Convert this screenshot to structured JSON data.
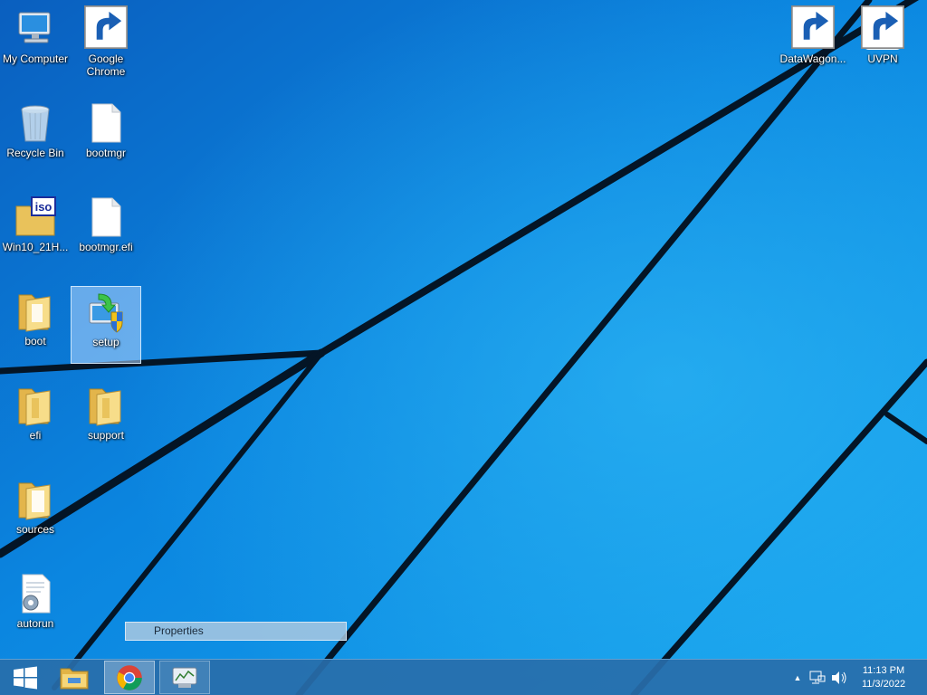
{
  "desktop": {
    "icons": [
      {
        "label": "My Computer"
      },
      {
        "label": "Google Chrome"
      },
      {
        "label": "Recycle Bin"
      },
      {
        "label": "bootmgr"
      },
      {
        "label": "Win10_21H..."
      },
      {
        "label": "bootmgr.efi"
      },
      {
        "label": "boot"
      },
      {
        "label": "setup"
      },
      {
        "label": "efi"
      },
      {
        "label": "support"
      },
      {
        "label": "sources"
      },
      {
        "label": "autorun"
      },
      {
        "label": "DataWagon..."
      },
      {
        "label": "UVPN"
      }
    ],
    "selected_icon": "setup"
  },
  "context_menu": {
    "items": [
      {
        "label": "Properties"
      }
    ]
  },
  "taskbar": {
    "buttons": [
      {
        "icon": "windows-start-icon"
      },
      {
        "icon": "file-explorer-icon"
      },
      {
        "icon": "chrome-icon"
      },
      {
        "icon": "performance-monitor-icon"
      }
    ],
    "tray": {
      "icons": [
        "show-hidden-icons-chevron",
        "network-icon",
        "volume-icon"
      ],
      "time": "11:13 PM",
      "date": "11/3/2022"
    }
  },
  "colors": {
    "wallpaper": "#0a70d2",
    "taskbar": "#286eaa",
    "selection": "#b4d7ff"
  }
}
